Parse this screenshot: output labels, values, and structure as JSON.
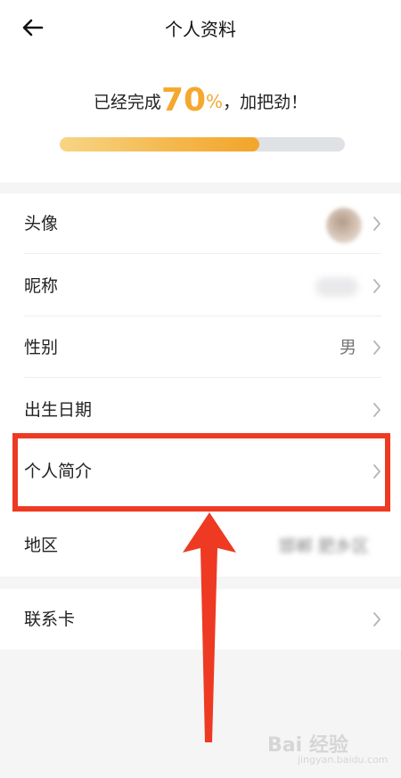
{
  "header": {
    "title": "个人资料",
    "back_icon": "arrow-left-icon"
  },
  "progress": {
    "prefix": "已经完成",
    "value": 70,
    "percent_sign": "%",
    "suffix": "，加把劲！",
    "fraction": 0.7
  },
  "rows": [
    {
      "label": "头像"
    },
    {
      "label": "昵称"
    },
    {
      "label": "性别",
      "value": "男"
    },
    {
      "label": "出生日期"
    },
    {
      "label": "个人简介"
    },
    {
      "label": "地区",
      "value": "邯郸 肥乡区"
    },
    {
      "label": "联系卡"
    }
  ],
  "watermark": {
    "main": "Bai 经验",
    "sub": "jingyan.baidu.com"
  },
  "colors": {
    "accent": "#f4a82e",
    "highlight": "#ee3a23",
    "track": "#dfe1e5",
    "background": "#f5f5f6"
  }
}
